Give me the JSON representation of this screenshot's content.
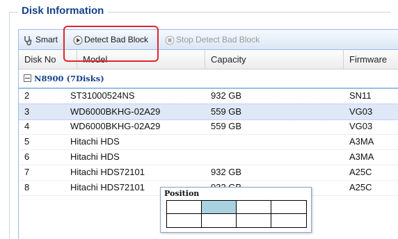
{
  "section": {
    "title": "Disk Information"
  },
  "toolbar": {
    "smart_label": "Smart",
    "detect_label": "Detect Bad Block",
    "stop_label": "Stop Detect Bad Block"
  },
  "grid": {
    "columns": [
      "Disk No",
      "Model",
      "Capacity",
      "Firmware"
    ],
    "group": "N8900 (7Disks)",
    "rows": [
      {
        "disk_no": "2",
        "model": "ST31000524NS",
        "capacity": "932 GB",
        "firmware": "SN11"
      },
      {
        "disk_no": "3",
        "model": "WD6000BKHG-02A29",
        "capacity": "559 GB",
        "firmware": "VG03"
      },
      {
        "disk_no": "4",
        "model": "WD6000BKHG-02A29",
        "capacity": "559 GB",
        "firmware": "VG03"
      },
      {
        "disk_no": "5",
        "model": "Hitachi HDS",
        "capacity": "",
        "firmware": "A3MA"
      },
      {
        "disk_no": "6",
        "model": "Hitachi HDS",
        "capacity": "",
        "firmware": "A3MA"
      },
      {
        "disk_no": "7",
        "model": "Hitachi HDS72101",
        "capacity": "932 GB",
        "firmware": "A25C"
      },
      {
        "disk_no": "8",
        "model": "Hitachi HDS72101",
        "capacity": "932 GB",
        "firmware": "A25C"
      }
    ],
    "selected_disk_no": "3"
  },
  "position_popup": {
    "title": "Position",
    "columns": 4,
    "rows": 2,
    "active_slot": 2
  },
  "colors": {
    "accent": "#15428b",
    "highlight_box": "#e0242d",
    "selected_row": "#dfe8f6",
    "active_slot": "#a8d2e0"
  }
}
